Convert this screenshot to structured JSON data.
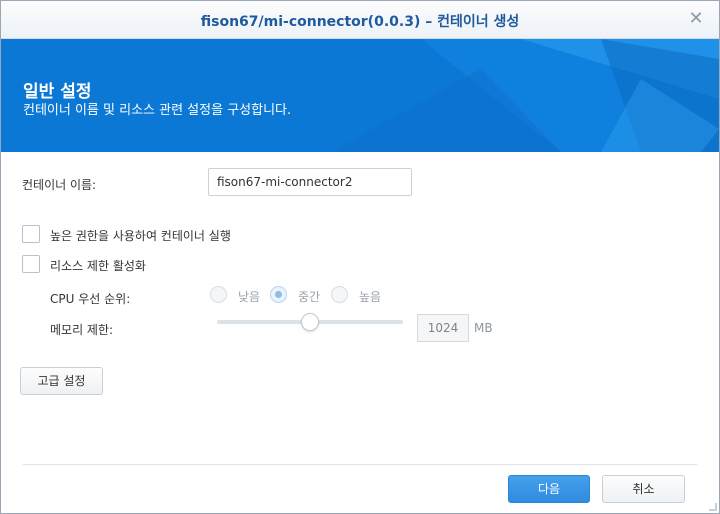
{
  "window": {
    "title": "fison67/mi-connector(0.0.3) – 컨테이너 생성",
    "close_glyph": "✕"
  },
  "banner": {
    "title": "일반 설정",
    "subtitle": "컨테이너 이름 및 리소스 관련 설정을 구성합니다."
  },
  "form": {
    "container_name_label": "컨테이너 이름:",
    "container_name_value": "fison67-mi-connector2",
    "privileged_label": "높은 권한을 사용하여 컨테이너 실행",
    "privileged_checked": false,
    "resource_limit_label": "리소스 제한 활성화",
    "resource_limit_checked": false,
    "cpu_priority_label": "CPU 우선 순위:",
    "cpu_options": [
      {
        "label": "낮음",
        "checked": false
      },
      {
        "label": "중간",
        "checked": true
      },
      {
        "label": "높음",
        "checked": false
      }
    ],
    "memory_label": "메모리 제한:",
    "memory_slider_fraction": 0.5,
    "memory_value": "1024",
    "memory_unit": "MB",
    "advanced_button": "고급 설정"
  },
  "footer": {
    "next_button": "다음",
    "cancel_button": "취소"
  },
  "colors": {
    "banner": "#0c78d6",
    "title_text": "#1f5a9e",
    "primary_button": "#2f8be0"
  }
}
